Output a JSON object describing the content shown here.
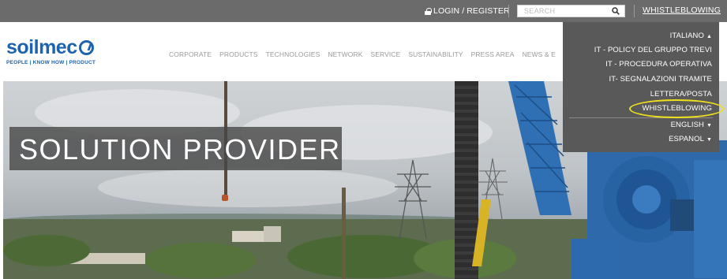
{
  "topbar": {
    "login_label": "LOGIN / REGISTER",
    "search_placeholder": "SEARCH",
    "whistleblowing_label": "WHISTLEBLOWING"
  },
  "header": {
    "logo_text": "soilmec",
    "tagline": "PEOPLE | KNOW HOW | PRODUCT",
    "nav": [
      "CORPORATE",
      "PRODUCTS",
      "TECHNOLOGIES",
      "NETWORK",
      "SERVICE",
      "SUSTAINABILITY",
      "PRESS AREA",
      "NEWS & E"
    ]
  },
  "hero": {
    "headline": "SOLUTION PROVIDER"
  },
  "dropdown": {
    "items": [
      "ITALIANO",
      "IT - POLICY DEL GRUPPO TREVI",
      "IT - PROCEDURA OPERATIVA",
      "IT- SEGNALAZIONI TRAMITE",
      "LETTERA/POSTA",
      "WHISTLEBLOWING",
      "ENGLISH",
      "ESPANOL"
    ]
  },
  "colors": {
    "topbar": "#6b6b6b",
    "brand_blue": "#1d63ad",
    "dropdown_bg": "#595959",
    "highlight_ring": "#f0e21a"
  }
}
